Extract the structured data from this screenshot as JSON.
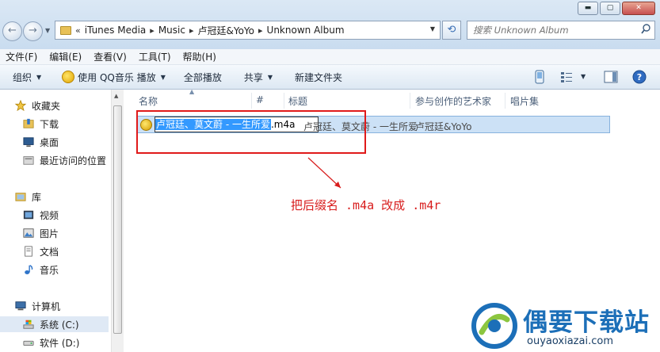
{
  "window": {
    "minimize": "▬",
    "maximize": "▢",
    "close": "✕"
  },
  "nav": {
    "back": "←",
    "forward": "→"
  },
  "address": {
    "breadcrumbs": [
      "iTunes Media",
      "Music",
      "卢冠廷&YoYo",
      "Unknown Album"
    ],
    "overflow": "«"
  },
  "search": {
    "placeholder": "搜索 Unknown Album"
  },
  "menu": [
    "文件(F)",
    "编辑(E)",
    "查看(V)",
    "工具(T)",
    "帮助(H)"
  ],
  "toolbar": {
    "organize": "组织",
    "play_with": "使用 QQ音乐 播放",
    "play_all": "全部播放",
    "share": "共享",
    "new_folder": "新建文件夹"
  },
  "sidebar": {
    "favorites": "收藏夹",
    "downloads": "下载",
    "desktop": "桌面",
    "recent": "最近访问的位置",
    "libraries": "库",
    "videos": "视频",
    "pictures": "图片",
    "documents": "文档",
    "music": "音乐",
    "computer": "计算机",
    "drive_c": "系统 (C:)",
    "drive_d": "软件 (D:)"
  },
  "columns": {
    "name": "名称",
    "number": "#",
    "title": "标题",
    "artist": "参与创作的艺术家",
    "album": "唱片集"
  },
  "file": {
    "rename_selected": "卢冠廷、莫文蔚 - 一生所爱",
    "rename_ext": ".m4a",
    "title": "卢冠廷、莫文蔚 - 一生所爱",
    "artist": "卢冠廷&YoYo"
  },
  "annotation": "把后缀名 .m4a 改成 .m4r",
  "watermark": {
    "title": "偶要下载站",
    "url": "ouyaoxiazai.com"
  },
  "colors": {
    "annotation": "#d81d1d",
    "selection": "#3399ff",
    "watermark": "#1c6fb8"
  }
}
